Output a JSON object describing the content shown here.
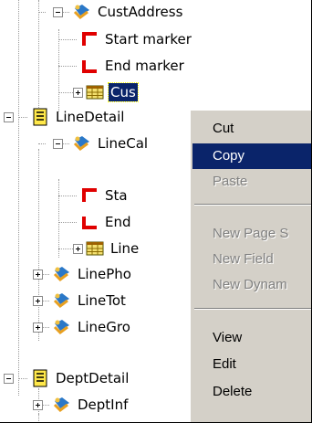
{
  "tree": {
    "nodes": {
      "cust_address": "CustAddress",
      "start_marker_1": "Start marker",
      "end_marker_1": "End marker",
      "cust_selected": "Cus",
      "line_detail": "LineDetail",
      "line_cal": "LineCal",
      "start_marker_2": "Sta",
      "end_marker_2": "End",
      "line_table": "Line",
      "line_pho": "LinePho",
      "line_tot": "LineTot",
      "line_gro": "LineGro",
      "dept_detail": "DeptDetail",
      "dept_inf": "DeptInf"
    }
  },
  "context_menu": {
    "items": {
      "cut": "Cut",
      "copy": "Copy",
      "paste": "Paste",
      "new_page": "New Page S",
      "new_field": "New Field",
      "new_dynamic": "New Dynam",
      "view": "View",
      "edit": "Edit",
      "delete": "Delete"
    }
  },
  "colors": {
    "selection": "#0a246a",
    "menu_bg": "#d4d0c8",
    "marker_red": "#e00000",
    "section_yellow": "#ffe84a"
  },
  "icons": [
    "expand-icon",
    "collapse-icon",
    "group-icon",
    "start-marker-icon",
    "end-marker-icon",
    "table-icon",
    "section-icon"
  ]
}
